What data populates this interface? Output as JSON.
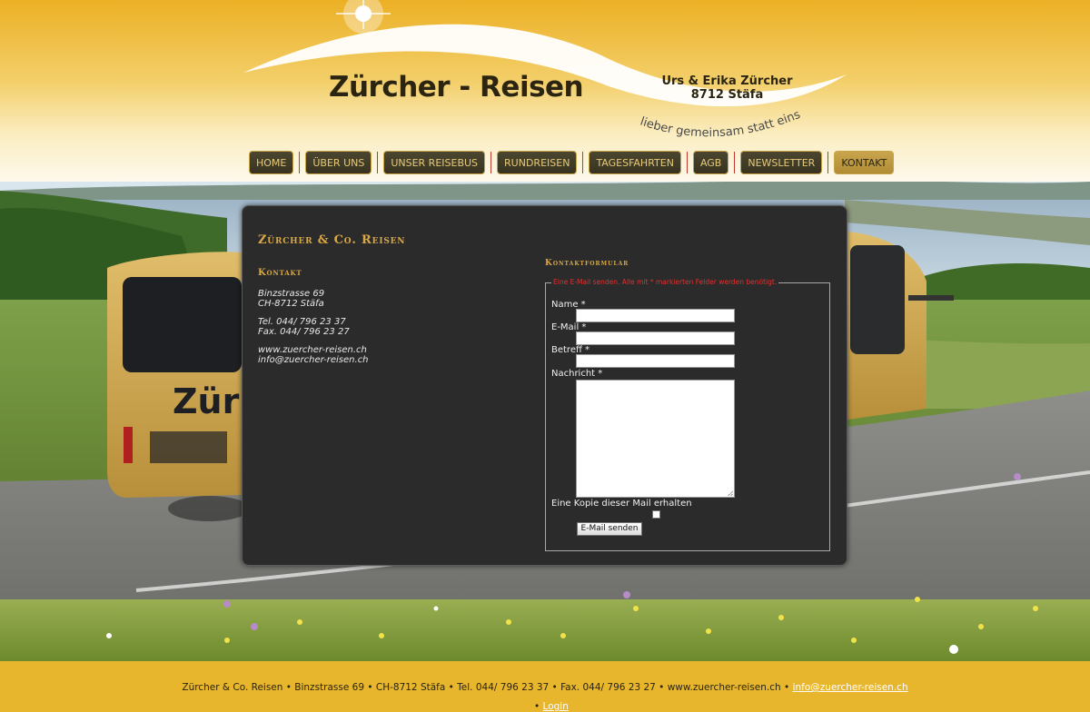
{
  "header": {
    "brand": "Zürcher - Reisen",
    "owner_line1": "Urs & Erika Zürcher",
    "owner_line2": "8712 Stäfa",
    "slogan": "lieber gemeinsam statt einsam"
  },
  "nav": {
    "items": [
      {
        "label": "HOME"
      },
      {
        "label": "ÜBER UNS"
      },
      {
        "label": "UNSER REISEBUS"
      },
      {
        "label": "RUNDREISEN"
      },
      {
        "label": "TAGESFAHRTEN"
      },
      {
        "label": "AGB"
      },
      {
        "label": "NEWSLETTER"
      },
      {
        "label": "KONTAKT"
      }
    ],
    "active": "KONTAKT"
  },
  "content": {
    "title": "Zürcher & Co. Reisen",
    "kontakt_heading": "Kontakt",
    "address": {
      "street": "Binzstrasse 69",
      "city": "CH-8712 Stäfa",
      "tel": "Tel. 044/ 796 23 37",
      "fax": "Fax. 044/ 796 23 27",
      "web": "www.zuercher-reisen.ch",
      "email": "info@zuercher-reisen.ch"
    }
  },
  "form": {
    "heading": "Kontaktformular",
    "legend": "Eine E-Mail senden. Alle mit * markierten Felder werden benötigt.",
    "name_label": "Name *",
    "email_label": "E-Mail *",
    "subject_label": "Betreff *",
    "message_label": "Nachricht *",
    "copy_label": "Eine Kopie dieser Mail erhalten",
    "submit_label": "E-Mail senden"
  },
  "footer": {
    "text": "Zürcher & Co. Reisen • Binzstrasse 69 • CH-8712 Stäfa • Tel. 044/ 796 23 37 • Fax. 044/ 796 23 27 • www.zuercher-reisen.ch •",
    "email": "info@zuercher-reisen.ch",
    "bullet": "•",
    "login": "Login"
  },
  "colors": {
    "header_gold": "#ecb025",
    "nav_dark": "#3d3823",
    "nav_text": "#e7c97a",
    "panel_bg": "#2b2b2b",
    "heading_gold": "#d8a848",
    "legend_red": "#e03030",
    "footer_bg": "#e8b62d"
  }
}
